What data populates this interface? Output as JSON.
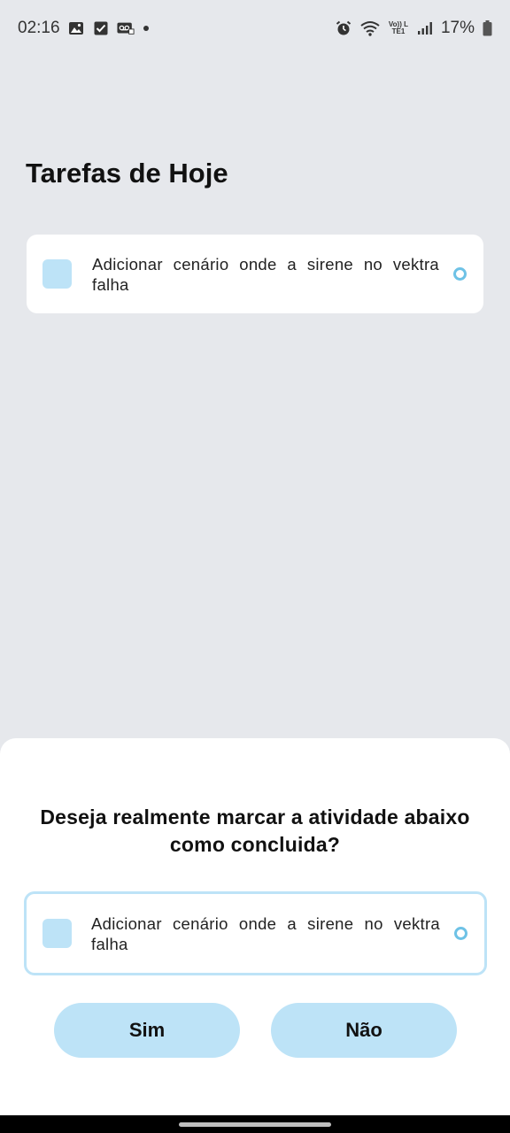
{
  "status_bar": {
    "time": "02:16",
    "left_icons": [
      "image-icon",
      "checkbox-icon",
      "voicemail-icon"
    ],
    "right_icons": [
      "alarm-icon",
      "wifi-icon",
      "volte-icon",
      "signal-icon"
    ],
    "volte_text": "Vo)) LTE1",
    "battery_percent": "17%",
    "battery_level": 0.17
  },
  "page": {
    "title": "Tarefas de Hoje"
  },
  "tasks": [
    {
      "text": "Adicionar cenário onde a sirene no vektra falha",
      "completed": false
    }
  ],
  "dialog": {
    "question": "Deseja realmente marcar a atividade abaixo como concluida?",
    "task_text": "Adicionar cenário onde a sirene no vektra falha",
    "yes_label": "Sim",
    "no_label": "Não"
  },
  "colors": {
    "background": "#e6e8ec",
    "accent": "#bde3f7",
    "status_ring": "#6ec2e6",
    "card": "#ffffff"
  }
}
